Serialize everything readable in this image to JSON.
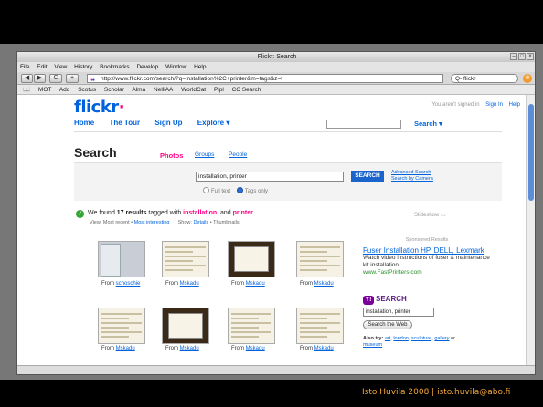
{
  "window": {
    "title": "Flickr: Search"
  },
  "menu": [
    "File",
    "Edit",
    "View",
    "History",
    "Bookmarks",
    "Develop",
    "Window",
    "Help"
  ],
  "nav": {
    "back": "◀",
    "forward": "▶",
    "reload": "C",
    "add": "+",
    "url": "http://www.flickr.com/search/?q=installation%2C+printer&m=tags&z=t",
    "search_value": "Q- flickr"
  },
  "bookmarks": [
    "MOT",
    "Add",
    "Scotus",
    "Scholar",
    "Alma",
    "NelliAA",
    "WorldCat",
    "Pipl",
    "CC Search"
  ],
  "flickr": {
    "logo_main": "flickr",
    "logo_dot": "·",
    "nav": [
      "Home",
      "The Tour",
      "Sign Up",
      "Explore ▾"
    ],
    "signin_text": "You aren't signed in",
    "signin_link": "Sign In",
    "help_link": "Help",
    "top_search_label": "Search ▾",
    "search_heading": "Search",
    "tabs": {
      "photos": "Photos",
      "groups": "Groups",
      "people": "People"
    },
    "query": "installation, printer",
    "search_button": "SEARCH",
    "advanced_search": "Advanced Search",
    "search_by_camera": "Search by Camera",
    "full_text": "Full text",
    "tags_only": "Tags only",
    "found_prefix": "We found ",
    "found_count": "17 results",
    "found_mid": " tagged with ",
    "tag1": "installation",
    "found_and": ", and ",
    "tag2": "printer",
    "found_end": ".",
    "view_label": "View:",
    "most_recent": "Most recent",
    "most_interesting": "Most interesting",
    "show_label": "Show:",
    "details": "Details",
    "thumbnails": "Thumbnails",
    "slideshow": "Slideshow",
    "from": "From",
    "results": [
      {
        "user": "schoschie",
        "style": "photo"
      },
      {
        "user": "Mskadu",
        "style": "light"
      },
      {
        "user": "Mskadu",
        "style": "dark"
      },
      {
        "user": "Mskadu",
        "style": "light"
      },
      {
        "user": "Mskadu",
        "style": "light"
      },
      {
        "user": "Mskadu",
        "style": "dark"
      },
      {
        "user": "Mskadu",
        "style": "light"
      },
      {
        "user": "Mskadu",
        "style": "light"
      }
    ],
    "sponsor": {
      "heading": "Sponsored Results",
      "title": "Fuser Installation HP, DELL, Lexmark",
      "desc": "Watch video instructions of fuser & maintenance kit installation.",
      "url": "www.FastPrinters.com"
    },
    "yahoo": {
      "badge": "Y!",
      "label": "SEARCH",
      "query": "installation, printer",
      "button": "Search the Web",
      "also_label": "Also try:",
      "also": [
        "art",
        "london",
        "sculpture",
        "gallery",
        "museum"
      ]
    }
  },
  "footer": "Isto Huvila 2008 | isto.huvila@abo.fi"
}
